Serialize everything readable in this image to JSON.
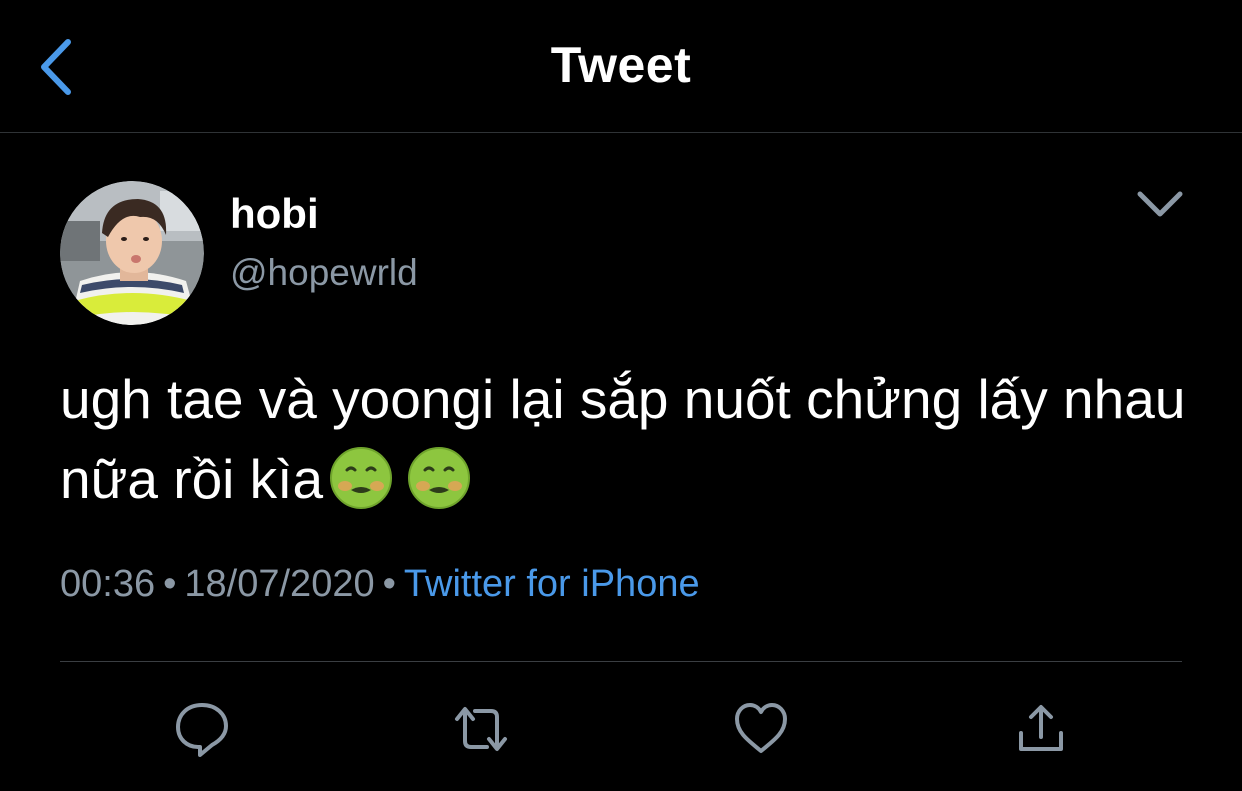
{
  "header": {
    "title": "Tweet",
    "back_icon": "chevron-left-icon"
  },
  "author": {
    "display_name": "hobi",
    "handle": "@hopewrld",
    "avatar_icon": "user-avatar"
  },
  "tweet": {
    "text": "ugh tae và yoongi lại sắp nuốt chửng lấy nhau nữa rồi kìa",
    "emojis": [
      "nauseated-face-emoji",
      "nauseated-face-emoji"
    ]
  },
  "meta": {
    "time": "00:36",
    "separator": "•",
    "date": "18/07/2020",
    "source": "Twitter for iPhone"
  },
  "actions": {
    "reply_icon": "reply-icon",
    "retweet_icon": "retweet-icon",
    "like_icon": "heart-icon",
    "share_icon": "share-icon"
  },
  "colors": {
    "background": "#000000",
    "text": "#ffffff",
    "secondary": "#8b98a5",
    "accent": "#4a99e9",
    "icon": "#8b98a5"
  }
}
